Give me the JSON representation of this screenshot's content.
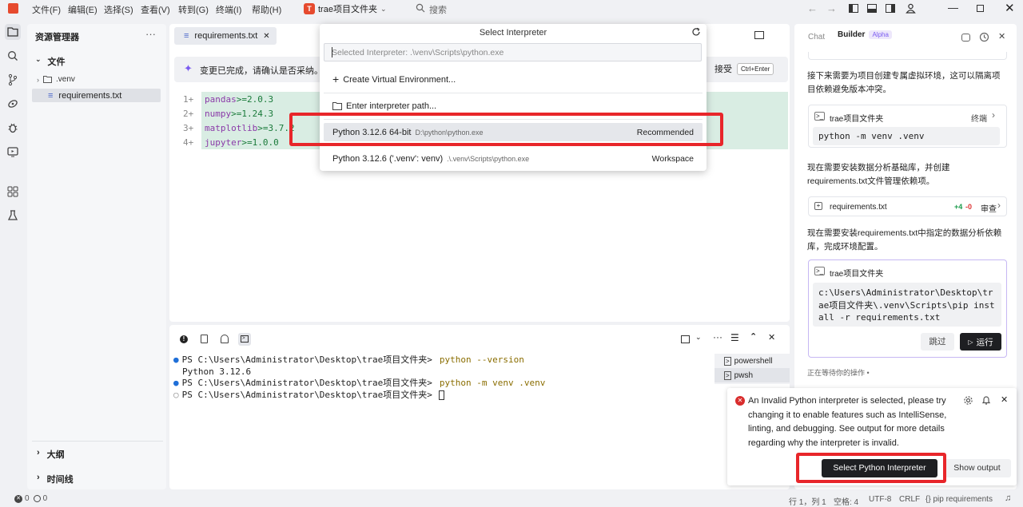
{
  "menu": [
    "文件(F)",
    "编辑(E)",
    "选择(S)",
    "查看(V)",
    "转到(G)",
    "终端(I)",
    "帮助(H)"
  ],
  "project": {
    "logo_letter": "T",
    "name": "trae项目文件夹"
  },
  "search": {
    "placeholder": "搜索"
  },
  "explorer": {
    "title": "资源管理器",
    "folder_label": "文件",
    "items": [
      ".venv",
      "requirements.txt"
    ],
    "outline": "大纲",
    "timeline": "时间线"
  },
  "editor": {
    "tab_label": "requirements.txt",
    "banner_text": "变更已完成，请确认是否采纳。",
    "accept_label": "接受",
    "accept_shortcut": "Ctrl+Enter",
    "lines": [
      {
        "num": "1+",
        "pkg": "pandas",
        "ver": ">=2.0.3"
      },
      {
        "num": "2+",
        "pkg": "numpy",
        "ver": ">=1.24.3"
      },
      {
        "num": "3+",
        "pkg": "matplotlib",
        "ver": ">=3.7.2"
      },
      {
        "num": "4+",
        "pkg": "jupyter",
        "ver": ">=1.0.0"
      }
    ]
  },
  "terminal": {
    "lines": [
      {
        "prompt": "PS C:\\Users\\Administrator\\Desktop\\trae项目文件夹>",
        "cmd": "python --version",
        "dot": "blue"
      },
      {
        "prompt": "Python 3.12.6",
        "cmd": "",
        "dot": "none"
      },
      {
        "prompt": "PS C:\\Users\\Administrator\\Desktop\\trae项目文件夹>",
        "cmd": "python -m venv .venv",
        "dot": "blue"
      },
      {
        "prompt": "PS C:\\Users\\Administrator\\Desktop\\trae项目文件夹>",
        "cmd": "",
        "dot": "empty"
      }
    ],
    "shells": [
      "powershell",
      "pwsh"
    ]
  },
  "popup": {
    "title": "Select Interpreter",
    "input_placeholder": "Selected Interpreter: .\\venv\\Scripts\\python.exe",
    "create_env": "Create Virtual Environment...",
    "enter_path": "Enter interpreter path...",
    "options": [
      {
        "name": "Python 3.12.6 64-bit",
        "path": "D:\\python\\python.exe",
        "tag": "Recommended"
      },
      {
        "name": "Python 3.12.6 ('.venv': venv)",
        "path": ".\\.venv\\Scripts\\python.exe",
        "tag": "Workspace"
      }
    ]
  },
  "chat": {
    "tab_chat": "Chat",
    "tab_builder": "Builder",
    "badge": "Alpha",
    "para1": "接下来需要为项目创建专属虚拟环境，这可以隔离项目依赖避免版本冲突。",
    "card1_title": "trae项目文件夹",
    "card1_action": "终端",
    "card1_code": "python -m venv .venv",
    "para2": "现在需要安装数据分析基础库，并创建requirements.txt文件管理依赖项。",
    "file_name": "requirements.txt",
    "file_add": "+4",
    "file_del": "-0",
    "file_action": "审查",
    "para3": "现在需要安装requirements.txt中指定的数据分析依赖库，完成环境配置。",
    "card2_title": "trae项目文件夹",
    "card2_code": "c:\\Users\\Administrator\\Desktop\\trae项目文件夹\\.venv\\Scripts\\pip install -r requirements.txt",
    "skip": "跳过",
    "run": "运行",
    "waiting": "正在等待你的操作 •"
  },
  "notification": {
    "message": "An Invalid Python interpreter is selected, please try changing it to enable features such as IntelliSense, linting, and debugging. See output for more details regarding why the interpreter is invalid.",
    "primary": "Select Python Interpreter",
    "secondary": "Show output"
  },
  "status": {
    "errors": "0",
    "warnings": "0",
    "position": "行 1，列 1",
    "spaces": "空格: 4",
    "encoding": "UTF-8",
    "eol": "CRLF",
    "lang": "{} pip requirements"
  },
  "colors": {
    "accent": "#e64a2e",
    "highlight": "#e8262a",
    "diff_add": "#d9ede3"
  }
}
